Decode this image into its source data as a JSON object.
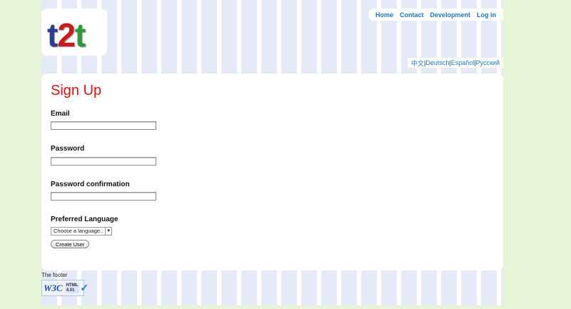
{
  "logo": {
    "part1": "t",
    "part2": "2",
    "part3": "t"
  },
  "nav": {
    "home": "Home",
    "contact": "Contact",
    "development": "Development",
    "login": "Log in"
  },
  "languages": {
    "zh": "中文",
    "de": "Deutsch",
    "es": "Español",
    "ru": "Русский",
    "sep": "|"
  },
  "form": {
    "title": "Sign Up",
    "email_label": "Email",
    "email_value": "",
    "password_label": "Password",
    "password_value": "",
    "password_confirm_label": "Password confirmation",
    "password_confirm_value": "",
    "language_label": "Preferred Language",
    "language_selected": "Choose a language..",
    "submit_label": "Create User"
  },
  "footer": {
    "text": "The footer",
    "badge_w3c": "W3C",
    "badge_html": "HTML",
    "badge_version": "4.01"
  },
  "colors": {
    "title": "#e01010",
    "link": "#1d78c1",
    "page_bg": "#e8f4d8",
    "stripe": "#e4eaf8"
  }
}
